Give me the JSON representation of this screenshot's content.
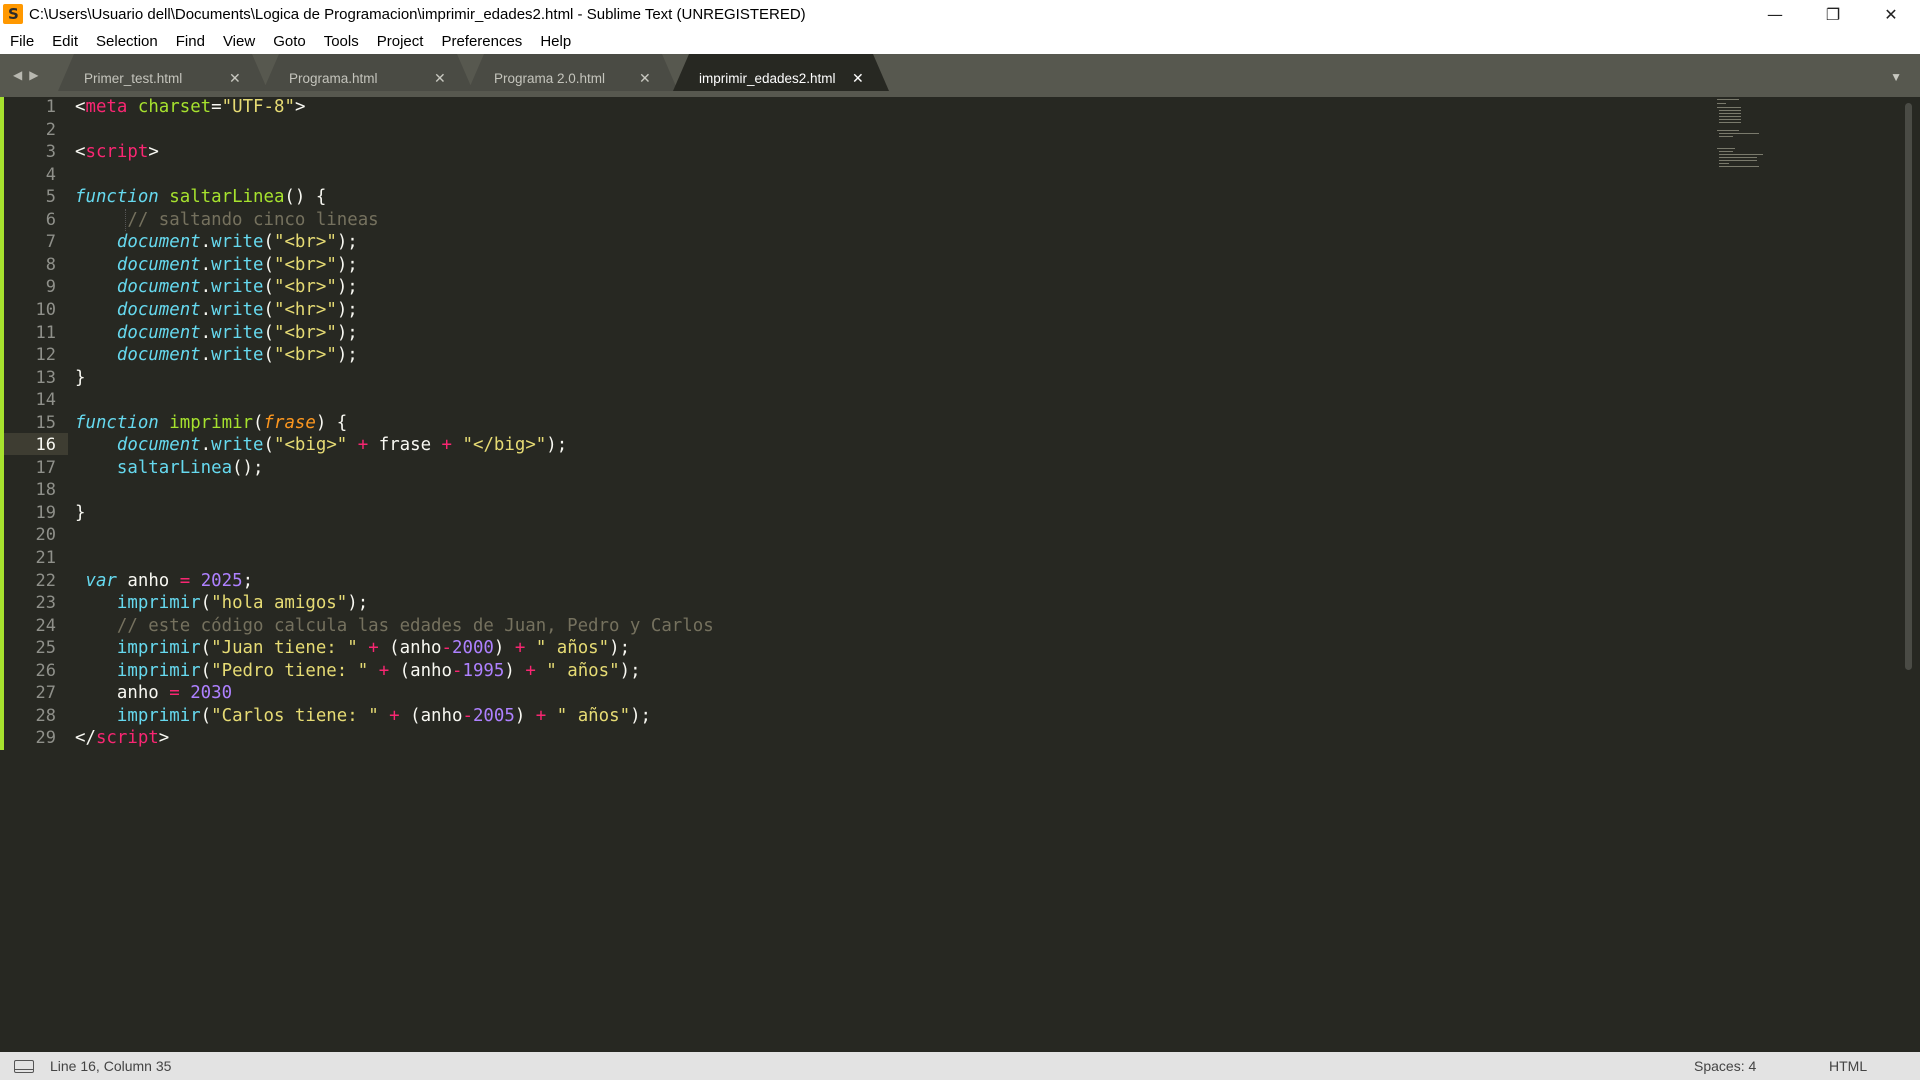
{
  "window": {
    "title": "C:\\Users\\Usuario dell\\Documents\\Logica de Programacion\\imprimir_edades2.html - Sublime Text (UNREGISTERED)",
    "controls": {
      "minimize": "—",
      "restore": "❐",
      "close": "✕"
    }
  },
  "menu": [
    "File",
    "Edit",
    "Selection",
    "Find",
    "View",
    "Goto",
    "Tools",
    "Project",
    "Preferences",
    "Help"
  ],
  "tabs": [
    {
      "label": "Primer_test.html",
      "active": false
    },
    {
      "label": "Programa.html",
      "active": false
    },
    {
      "label": "Programa 2.0.html",
      "active": false
    },
    {
      "label": "imprimir_edades2.html",
      "active": true
    }
  ],
  "line_numbers": [
    "1",
    "2",
    "3",
    "4",
    "5",
    "6",
    "7",
    "8",
    "9",
    "10",
    "11",
    "12",
    "13",
    "14",
    "15",
    "16",
    "17",
    "18",
    "19",
    "20",
    "21",
    "22",
    "23",
    "24",
    "25",
    "26",
    "27",
    "28",
    "29"
  ],
  "code_lines": [
    [
      [
        "c-plain",
        "<"
      ],
      [
        "c-tag",
        "meta"
      ],
      [
        "c-plain",
        " "
      ],
      [
        "c-attr",
        "charset"
      ],
      [
        "c-plain",
        "="
      ],
      [
        "c-str",
        "\"UTF-8\""
      ],
      [
        "c-plain",
        ">"
      ]
    ],
    [],
    [
      [
        "c-plain",
        "<"
      ],
      [
        "c-tag",
        "script"
      ],
      [
        "c-plain",
        ">"
      ]
    ],
    [],
    [
      [
        "c-kw",
        "function"
      ],
      [
        "c-plain",
        " "
      ],
      [
        "c-fn",
        "saltarLinea"
      ],
      [
        "c-plain",
        "() {"
      ]
    ],
    [
      [
        "c-plain",
        "     "
      ],
      [
        "c-cmt",
        "// saltando cinco lineas"
      ]
    ],
    [
      [
        "c-plain",
        "    "
      ],
      [
        "c-obj",
        "document"
      ],
      [
        "c-plain",
        "."
      ],
      [
        "c-meth",
        "write"
      ],
      [
        "c-plain",
        "("
      ],
      [
        "c-str",
        "\"<br>\""
      ],
      [
        "c-plain",
        ");"
      ]
    ],
    [
      [
        "c-plain",
        "    "
      ],
      [
        "c-obj",
        "document"
      ],
      [
        "c-plain",
        "."
      ],
      [
        "c-meth",
        "write"
      ],
      [
        "c-plain",
        "("
      ],
      [
        "c-str",
        "\"<br>\""
      ],
      [
        "c-plain",
        ");"
      ]
    ],
    [
      [
        "c-plain",
        "    "
      ],
      [
        "c-obj",
        "document"
      ],
      [
        "c-plain",
        "."
      ],
      [
        "c-meth",
        "write"
      ],
      [
        "c-plain",
        "("
      ],
      [
        "c-str",
        "\"<br>\""
      ],
      [
        "c-plain",
        ");"
      ]
    ],
    [
      [
        "c-plain",
        "    "
      ],
      [
        "c-obj",
        "document"
      ],
      [
        "c-plain",
        "."
      ],
      [
        "c-meth",
        "write"
      ],
      [
        "c-plain",
        "("
      ],
      [
        "c-str",
        "\"<hr>\""
      ],
      [
        "c-plain",
        ");"
      ]
    ],
    [
      [
        "c-plain",
        "    "
      ],
      [
        "c-obj",
        "document"
      ],
      [
        "c-plain",
        "."
      ],
      [
        "c-meth",
        "write"
      ],
      [
        "c-plain",
        "("
      ],
      [
        "c-str",
        "\"<br>\""
      ],
      [
        "c-plain",
        ");"
      ]
    ],
    [
      [
        "c-plain",
        "    "
      ],
      [
        "c-obj",
        "document"
      ],
      [
        "c-plain",
        "."
      ],
      [
        "c-meth",
        "write"
      ],
      [
        "c-plain",
        "("
      ],
      [
        "c-str",
        "\"<br>\""
      ],
      [
        "c-plain",
        ");"
      ]
    ],
    [
      [
        "c-plain",
        "}"
      ]
    ],
    [],
    [
      [
        "c-kw",
        "function"
      ],
      [
        "c-plain",
        " "
      ],
      [
        "c-fn",
        "imprimir"
      ],
      [
        "c-plain",
        "("
      ],
      [
        "c-param",
        "frase"
      ],
      [
        "c-plain",
        ") {"
      ]
    ],
    [
      [
        "c-plain",
        "    "
      ],
      [
        "c-obj",
        "document"
      ],
      [
        "c-plain",
        "."
      ],
      [
        "c-meth",
        "write"
      ],
      [
        "c-plain",
        "("
      ],
      [
        "c-str",
        "\"<big>\""
      ],
      [
        "c-plain",
        " "
      ],
      [
        "c-op",
        "+"
      ],
      [
        "c-plain",
        " frase "
      ],
      [
        "c-op",
        "+"
      ],
      [
        "c-plain",
        " "
      ],
      [
        "c-str",
        "\"</big>\""
      ],
      [
        "c-plain",
        ");"
      ]
    ],
    [
      [
        "c-plain",
        "    "
      ],
      [
        "c-meth",
        "saltarLinea"
      ],
      [
        "c-plain",
        "();"
      ]
    ],
    [],
    [
      [
        "c-plain",
        "}"
      ]
    ],
    [],
    [],
    [
      [
        "c-plain",
        " "
      ],
      [
        "c-kw",
        "var"
      ],
      [
        "c-plain",
        " anho "
      ],
      [
        "c-op",
        "="
      ],
      [
        "c-plain",
        " "
      ],
      [
        "c-num",
        "2025"
      ],
      [
        "c-plain",
        ";"
      ]
    ],
    [
      [
        "c-plain",
        "    "
      ],
      [
        "c-meth",
        "imprimir"
      ],
      [
        "c-plain",
        "("
      ],
      [
        "c-str",
        "\"hola amigos\""
      ],
      [
        "c-plain",
        ");"
      ]
    ],
    [
      [
        "c-plain",
        "    "
      ],
      [
        "c-cmt",
        "// este código calcula las edades de Juan, Pedro y Carlos"
      ]
    ],
    [
      [
        "c-plain",
        "    "
      ],
      [
        "c-meth",
        "imprimir"
      ],
      [
        "c-plain",
        "("
      ],
      [
        "c-str",
        "\"Juan tiene: \""
      ],
      [
        "c-plain",
        " "
      ],
      [
        "c-op",
        "+"
      ],
      [
        "c-plain",
        " (anho"
      ],
      [
        "c-op",
        "-"
      ],
      [
        "c-num",
        "2000"
      ],
      [
        "c-plain",
        ") "
      ],
      [
        "c-op",
        "+"
      ],
      [
        "c-plain",
        " "
      ],
      [
        "c-str",
        "\" años\""
      ],
      [
        "c-plain",
        ");"
      ]
    ],
    [
      [
        "c-plain",
        "    "
      ],
      [
        "c-meth",
        "imprimir"
      ],
      [
        "c-plain",
        "("
      ],
      [
        "c-str",
        "\"Pedro tiene: \""
      ],
      [
        "c-plain",
        " "
      ],
      [
        "c-op",
        "+"
      ],
      [
        "c-plain",
        " (anho"
      ],
      [
        "c-op",
        "-"
      ],
      [
        "c-num",
        "1995"
      ],
      [
        "c-plain",
        ") "
      ],
      [
        "c-op",
        "+"
      ],
      [
        "c-plain",
        " "
      ],
      [
        "c-str",
        "\" años\""
      ],
      [
        "c-plain",
        ");"
      ]
    ],
    [
      [
        "c-plain",
        "    anho "
      ],
      [
        "c-op",
        "="
      ],
      [
        "c-plain",
        " "
      ],
      [
        "c-num",
        "2030"
      ]
    ],
    [
      [
        "c-plain",
        "    "
      ],
      [
        "c-meth",
        "imprimir"
      ],
      [
        "c-plain",
        "("
      ],
      [
        "c-str",
        "\"Carlos tiene: \""
      ],
      [
        "c-plain",
        " "
      ],
      [
        "c-op",
        "+"
      ],
      [
        "c-plain",
        " (anho"
      ],
      [
        "c-op",
        "-"
      ],
      [
        "c-num",
        "2005"
      ],
      [
        "c-plain",
        ") "
      ],
      [
        "c-op",
        "+"
      ],
      [
        "c-plain",
        " "
      ],
      [
        "c-str",
        "\" años\""
      ],
      [
        "c-plain",
        ");"
      ]
    ],
    [
      [
        "c-plain",
        "</"
      ],
      [
        "c-tag",
        "script"
      ],
      [
        "c-plain",
        ">"
      ]
    ]
  ],
  "current_line": 16,
  "status": {
    "position": "Line 16, Column 35",
    "spaces": "Spaces: 4",
    "syntax": "HTML"
  },
  "colors": {
    "editor_bg": "#272822",
    "tab_bar_bg": "#57584f",
    "active_tab_bg": "#272822",
    "inactive_tab_bg": "#4a4b44",
    "change_marker": "#a6e22e"
  }
}
